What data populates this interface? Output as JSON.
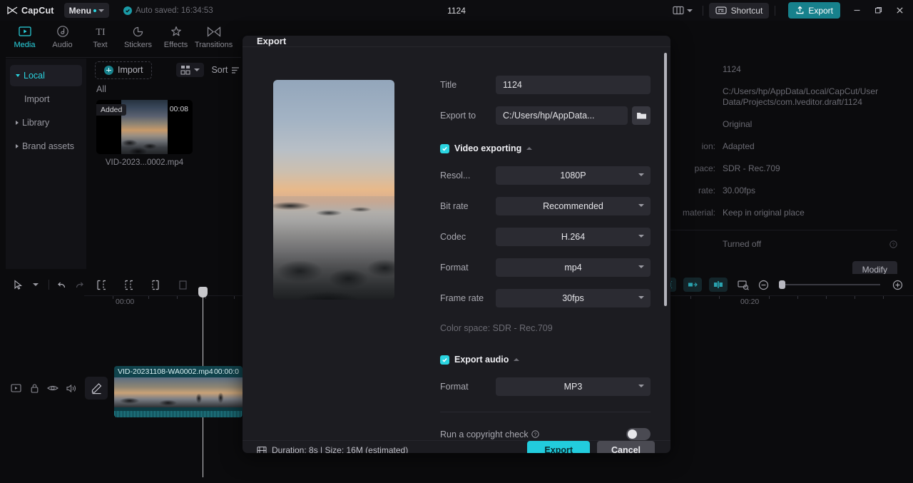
{
  "titlebar": {
    "app_name": "CapCut",
    "menu_label": "Menu",
    "autosave_text": "Auto saved: 16:34:53",
    "project_title": "1124",
    "shortcut_label": "Shortcut",
    "export_label": "Export",
    "accent_teal": "#2ad4e0",
    "export_btn_color": "#17818c"
  },
  "tooltabs": [
    {
      "label": "Media",
      "icon": "media-icon",
      "active": true
    },
    {
      "label": "Audio",
      "icon": "audio-icon",
      "active": false
    },
    {
      "label": "Text",
      "icon": "text-icon",
      "active": false
    },
    {
      "label": "Stickers",
      "icon": "stickers-icon",
      "active": false
    },
    {
      "label": "Effects",
      "icon": "effects-icon",
      "active": false
    },
    {
      "label": "Transitions",
      "icon": "transitions-icon",
      "active": false
    }
  ],
  "leftnav": [
    {
      "label": "Local",
      "active": true,
      "expandable": true,
      "sub": false
    },
    {
      "label": "Import",
      "active": false,
      "expandable": false,
      "sub": true
    },
    {
      "label": "Library",
      "active": false,
      "expandable": true,
      "sub": false
    },
    {
      "label": "Brand assets",
      "active": false,
      "expandable": true,
      "sub": false
    }
  ],
  "mediapanel": {
    "import_label": "Import",
    "sort_label": "Sort",
    "filter_label": "All",
    "item": {
      "badge": "Added",
      "duration": "00:08",
      "filename": "VID-2023...0002.mp4"
    }
  },
  "rightpanel": {
    "rows": [
      {
        "key": "",
        "value": "1124"
      },
      {
        "key": "",
        "value": "C:/Users/hp/AppData/Local/CapCut/User Data/Projects/com.lveditor.draft/1124"
      },
      {
        "key": "",
        "value": "Original"
      },
      {
        "key": "ion:",
        "value": "Adapted"
      },
      {
        "key": "pace:",
        "value": "SDR - Rec.709"
      },
      {
        "key": "rate:",
        "value": "30.00fps"
      },
      {
        "key": "material:",
        "value": "Keep in original place"
      }
    ],
    "status": "Turned off",
    "modify_label": "Modify"
  },
  "timeline": {
    "ruler_labels": [
      "00:00",
      "00:20"
    ],
    "clip": {
      "name": "VID-20231108-WA0002.mp4",
      "time": "00:00:0"
    }
  },
  "modal": {
    "title": "Export",
    "title_field": {
      "label": "Title",
      "value": "1124"
    },
    "export_to": {
      "label": "Export to",
      "value": "C:/Users/hp/AppData..."
    },
    "video_section": {
      "title": "Video exporting",
      "checked": true,
      "fields": [
        {
          "label": "Resol...",
          "value": "1080P"
        },
        {
          "label": "Bit rate",
          "value": "Recommended"
        },
        {
          "label": "Codec",
          "value": "H.264"
        },
        {
          "label": "Format",
          "value": "mp4"
        },
        {
          "label": "Frame rate",
          "value": "30fps"
        }
      ],
      "colorspace": "Color space: SDR - Rec.709"
    },
    "audio_section": {
      "title": "Export audio",
      "checked": true,
      "fields": [
        {
          "label": "Format",
          "value": "MP3"
        }
      ]
    },
    "copyright": {
      "label": "Run a copyright check",
      "enabled": false
    },
    "footer": {
      "info": "Duration: 8s | Size: 16M (estimated)",
      "export_label": "Export",
      "cancel_label": "Cancel"
    },
    "export_btn_color": "#22ccdd"
  }
}
